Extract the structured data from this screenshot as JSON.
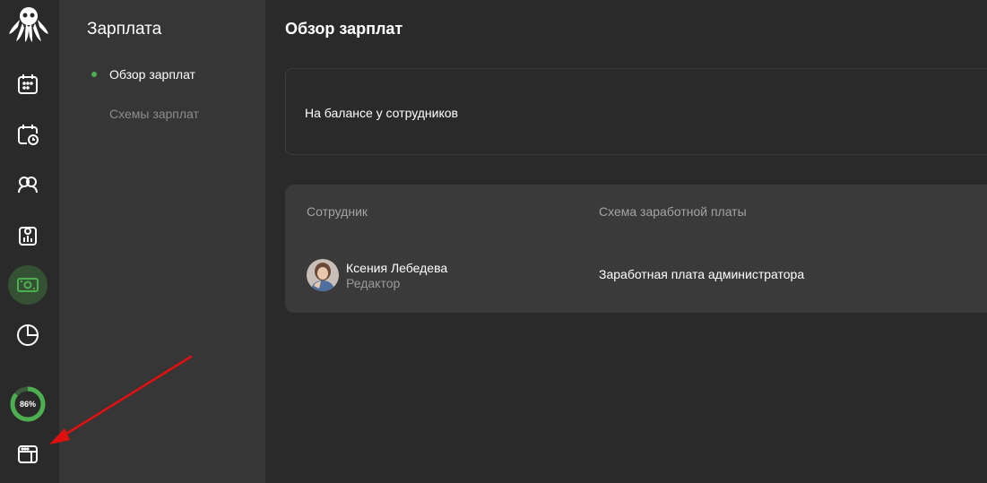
{
  "nav": {
    "section_title": "Зарплата",
    "items": [
      {
        "label": "Обзор зарплат",
        "active": true
      },
      {
        "label": "Схемы зарплат",
        "active": false
      }
    ]
  },
  "rail": {
    "icons": [
      "logo-octopus-icon",
      "calendar-icon",
      "calendar-clock-icon",
      "clients-icon",
      "clipboard-icon",
      "money-icon",
      "pie-chart-icon",
      "layout-icon"
    ],
    "progress_percent": 86,
    "progress_label": "86%"
  },
  "main": {
    "title": "Обзор зарплат",
    "balance_label": "На балансе у сотрудников",
    "table": {
      "headers": [
        "Сотрудник",
        "Схема заработной платы"
      ],
      "rows": [
        {
          "name": "Ксения Лебедева",
          "role": "Редактор",
          "scheme": "Заработная плата администратора"
        }
      ]
    }
  },
  "colors": {
    "accent": "#4caf50",
    "active_rail_bg": "#355134",
    "annotation_arrow": "#e01010"
  }
}
